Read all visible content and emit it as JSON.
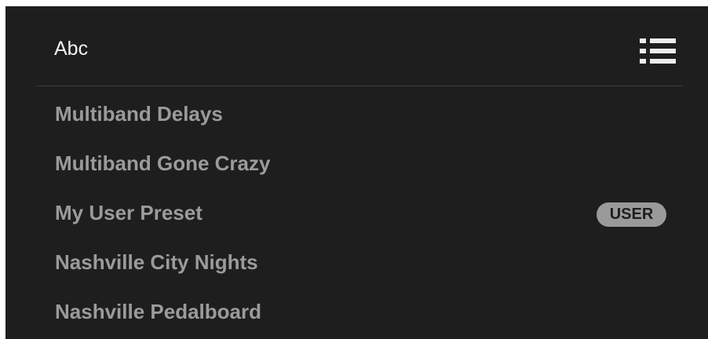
{
  "header": {
    "title": "Abc",
    "view_toggle_icon": "list-view-icon"
  },
  "presets": [
    {
      "label": "Multiband Delays",
      "badge": ""
    },
    {
      "label": "Multiband Gone Crazy",
      "badge": ""
    },
    {
      "label": "My User Preset",
      "badge": "USER"
    },
    {
      "label": "Nashville City Nights",
      "badge": ""
    },
    {
      "label": "Nashville Pedalboard",
      "badge": ""
    }
  ],
  "colors": {
    "background": "#1e1e1e",
    "title_text": "#f2f2f2",
    "item_text": "#9b9b9b",
    "badge_bg": "#9a9a9a",
    "divider": "#3c3c3c"
  }
}
